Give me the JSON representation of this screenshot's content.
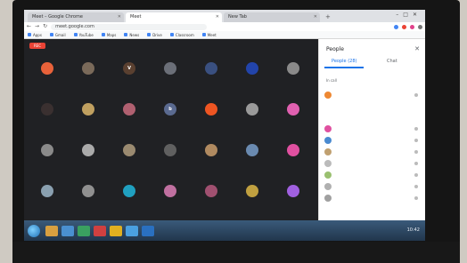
{
  "browser": {
    "tabs": [
      {
        "title": "Meet – Google Chrome",
        "active": false
      },
      {
        "title": "Meet",
        "active": true
      },
      {
        "title": "New Tab",
        "active": false
      }
    ],
    "url": "meet.google.com",
    "bookmarks": [
      "Apps",
      "Gmail",
      "YouTube",
      "Maps",
      "News",
      "Drive",
      "Classroom",
      "Meet"
    ]
  },
  "meet": {
    "rec_label": "REC",
    "participants": [
      {
        "initial": "",
        "color": "#e8623a"
      },
      {
        "initial": "",
        "color": "#7a6a5a"
      },
      {
        "initial": "V",
        "color": "#5a4030"
      },
      {
        "initial": "",
        "color": "#6b6f78"
      },
      {
        "initial": "",
        "color": "#3a5080"
      },
      {
        "initial": "",
        "color": "#2244aa"
      },
      {
        "initial": "",
        "color": "#8a8a8a"
      },
      {
        "initial": "",
        "color": "#3a3030"
      },
      {
        "initial": "",
        "color": "#c0a060"
      },
      {
        "initial": "",
        "color": "#b06070"
      },
      {
        "initial": "b",
        "color": "#5a6a90"
      },
      {
        "initial": "",
        "color": "#ee5522"
      },
      {
        "initial": "",
        "color": "#9a9a9a"
      },
      {
        "initial": "",
        "color": "#e060b0"
      },
      {
        "initial": "",
        "color": "#8a8a8a"
      },
      {
        "initial": "",
        "color": "#aaaaaa"
      },
      {
        "initial": "",
        "color": "#9a8a70"
      },
      {
        "initial": "",
        "color": "#606060"
      },
      {
        "initial": "",
        "color": "#b08a60"
      },
      {
        "initial": "",
        "color": "#6a8ab0"
      },
      {
        "initial": "",
        "color": "#e050a0"
      },
      {
        "initial": "",
        "color": "#8aa0b0"
      },
      {
        "initial": "",
        "color": "#909090"
      },
      {
        "initial": "",
        "color": "#20a0c0"
      },
      {
        "initial": "",
        "color": "#c070a0"
      },
      {
        "initial": "",
        "color": "#a05070"
      },
      {
        "initial": "",
        "color": "#c0a040"
      },
      {
        "initial": "",
        "color": "#a060e0"
      }
    ]
  },
  "panel": {
    "title": "People",
    "tab_people": "People (28)",
    "tab_chat": "Chat",
    "section_label": "In call",
    "host_color": "#ee8833",
    "rows": [
      {
        "color": "#e050a0"
      },
      {
        "color": "#4a8ad0"
      },
      {
        "color": "#c0a070"
      },
      {
        "color": "#bbbbbb"
      },
      {
        "color": "#9ac070"
      },
      {
        "color": "#b0b0b0"
      },
      {
        "color": "#a0a0a0"
      }
    ]
  },
  "taskbar": {
    "apps": [
      "#d8a040",
      "#4a90d0",
      "#3aa060",
      "#d04040",
      "#e0b020",
      "#4aa0e0",
      "#2a70c0"
    ],
    "time": "10:42"
  }
}
